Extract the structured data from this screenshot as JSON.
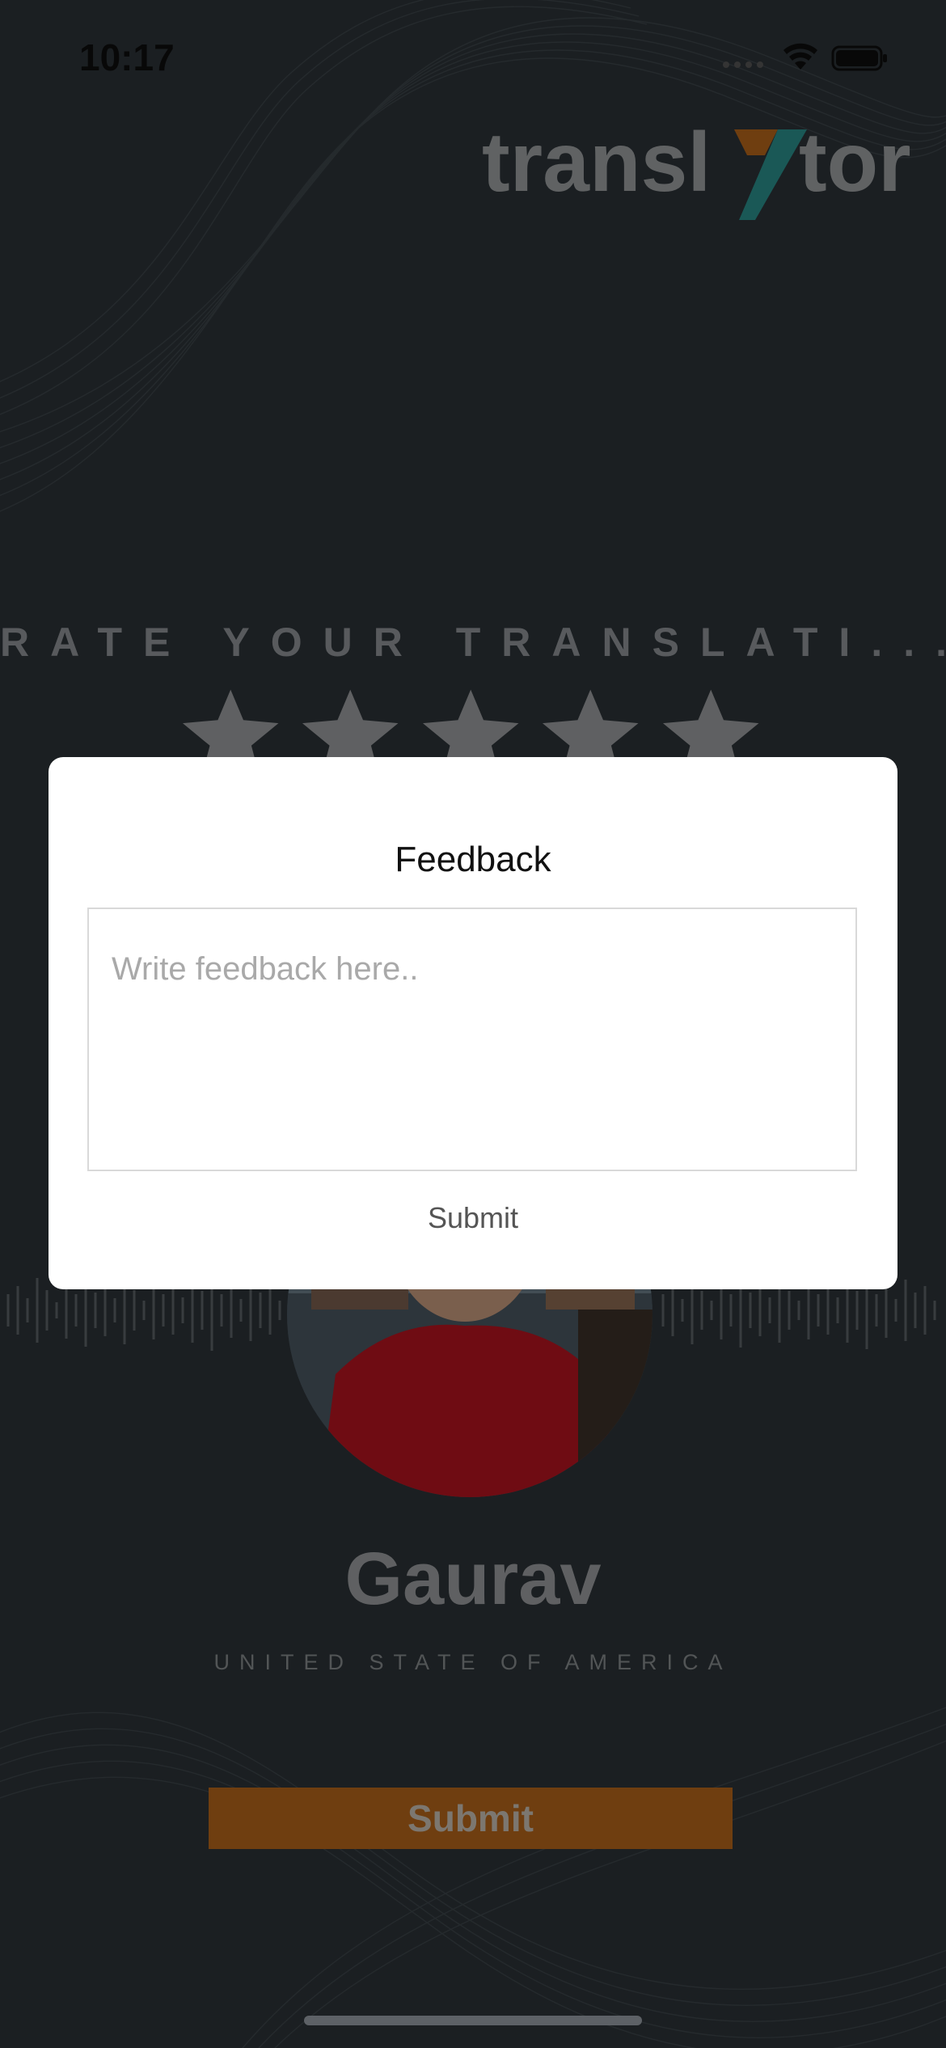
{
  "status_bar": {
    "time": "10:17"
  },
  "logo": {
    "text_left": "transl",
    "text_right": "tor"
  },
  "rating": {
    "title": "RATE YOUR TRANSLATI...",
    "stars_total": 5,
    "stars_selected": 0
  },
  "profile": {
    "name": "Gaurav",
    "country": "UNITED STATE OF AMERICA"
  },
  "main_submit_label": "Submit",
  "feedback_modal": {
    "title": "Feedback",
    "placeholder": "Write feedback here..",
    "submit_label": "Submit"
  },
  "colors": {
    "accent_orange": "#b3651b",
    "logo_teal": "#2a8f8c",
    "background": "#2c3338"
  }
}
